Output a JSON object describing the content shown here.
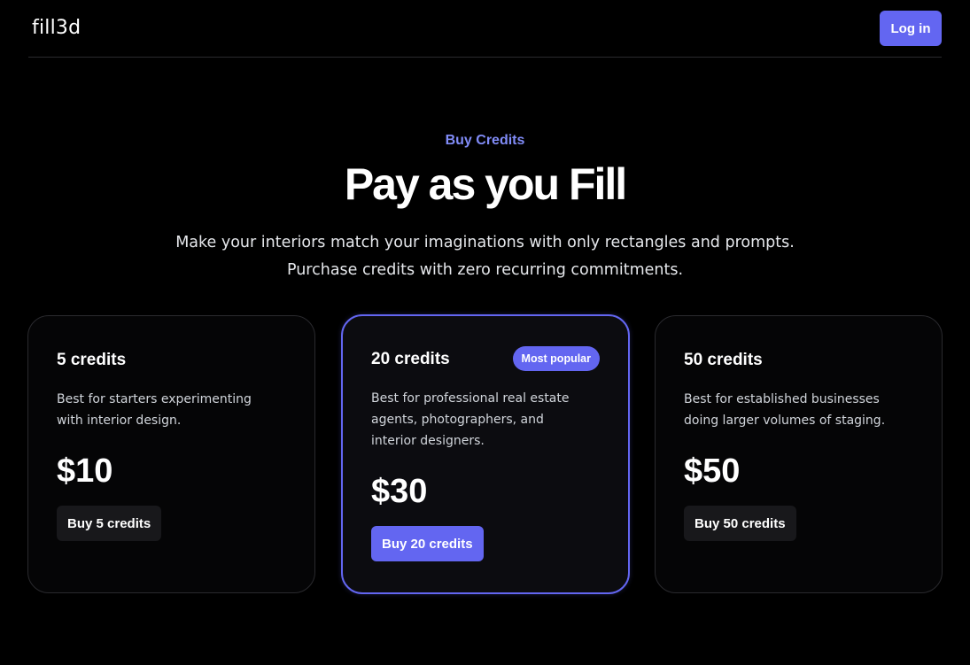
{
  "header": {
    "logo": "fill3d",
    "login_label": "Log in"
  },
  "hero": {
    "eyebrow": "Buy Credits",
    "title": "Pay as you Fill",
    "subtitle_line1": "Make your interiors match your imaginations with only rectangles and prompts.",
    "subtitle_line2": "Purchase credits with zero recurring commitments."
  },
  "plans": [
    {
      "name": "5 credits",
      "description": "Best for starters experimenting with interior design.",
      "price": "$10",
      "button_label": "Buy 5 credits"
    },
    {
      "name": "20 credits",
      "badge": "Most popular",
      "description": "Best for professional real estate agents, photographers, and interior designers.",
      "price": "$30",
      "button_label": "Buy 20 credits"
    },
    {
      "name": "50 credits",
      "description": "Best for established businesses doing larger volumes of staging.",
      "price": "$50",
      "button_label": "Buy 50 credits"
    }
  ],
  "colors": {
    "accent": "#6366f1",
    "eyebrow": "#818cf8",
    "background": "#000000",
    "secondary_button": "#18181b"
  }
}
